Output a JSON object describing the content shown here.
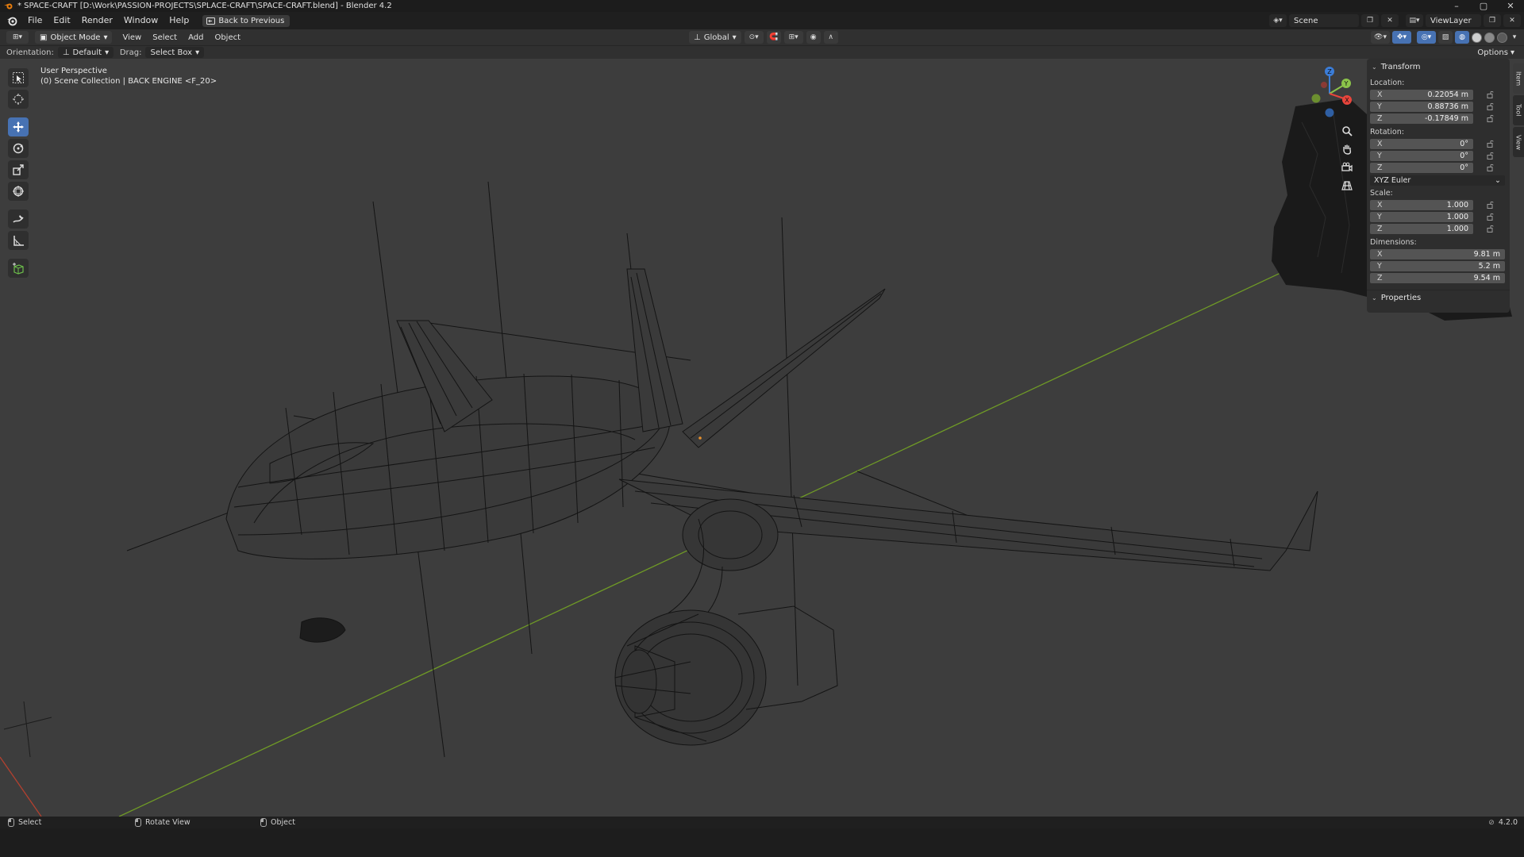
{
  "window": {
    "title": "* SPACE-CRAFT [D:\\Work\\PASSION-PROJECTS\\SPLACE-CRAFT\\SPACE-CRAFT.blend] - Blender 4.2",
    "controls": [
      "–",
      "▢",
      "✕"
    ]
  },
  "menubar": {
    "items": [
      "File",
      "Edit",
      "Render",
      "Window",
      "Help"
    ],
    "back_button": "Back to Previous",
    "scene": "Scene",
    "view_layer": "ViewLayer"
  },
  "header": {
    "mode": "Object Mode",
    "menus": [
      "View",
      "Select",
      "Add",
      "Object"
    ],
    "transform_orientation": "Global"
  },
  "toolsettings": {
    "orientation_label": "Orientation:",
    "orientation_value": "Default",
    "drag_label": "Drag:",
    "drag_value": "Select Box",
    "options_label": "Options"
  },
  "viewport": {
    "view_name": "User Perspective",
    "collection_info": "(0) Scene Collection | BACK ENGINE <F_20>"
  },
  "npanel": {
    "transform_title": "Transform",
    "location_label": "Location:",
    "location": [
      {
        "axis": "X",
        "value": "0.22054 m"
      },
      {
        "axis": "Y",
        "value": "0.88736 m"
      },
      {
        "axis": "Z",
        "value": "-0.17849 m"
      }
    ],
    "rotation_label": "Rotation:",
    "rotation": [
      {
        "axis": "X",
        "value": "0°"
      },
      {
        "axis": "Y",
        "value": "0°"
      },
      {
        "axis": "Z",
        "value": "0°"
      }
    ],
    "rotation_mode": "XYZ Euler",
    "scale_label": "Scale:",
    "scale": [
      {
        "axis": "X",
        "value": "1.000"
      },
      {
        "axis": "Y",
        "value": "1.000"
      },
      {
        "axis": "Z",
        "value": "1.000"
      }
    ],
    "dimensions_label": "Dimensions:",
    "dimensions": [
      {
        "axis": "X",
        "value": "9.81 m"
      },
      {
        "axis": "Y",
        "value": "5.2 m"
      },
      {
        "axis": "Z",
        "value": "9.54 m"
      }
    ],
    "properties_title": "Properties",
    "tabs": [
      "Item",
      "Tool",
      "View"
    ]
  },
  "gizmo": {
    "z_label": "Z",
    "y_label": "Y",
    "x_label": "X"
  },
  "statusbar": {
    "select": "Select",
    "rotate_view": "Rotate View",
    "object": "Object",
    "version": "4.2.0"
  },
  "colors": {
    "accent": "#4772b3",
    "viewport_bg": "#3d3d3d",
    "x_axis": "#e8453c",
    "y_axis": "#8bc34a",
    "z_axis": "#3b7dd8",
    "y_axis_line": "#6f9a26"
  }
}
